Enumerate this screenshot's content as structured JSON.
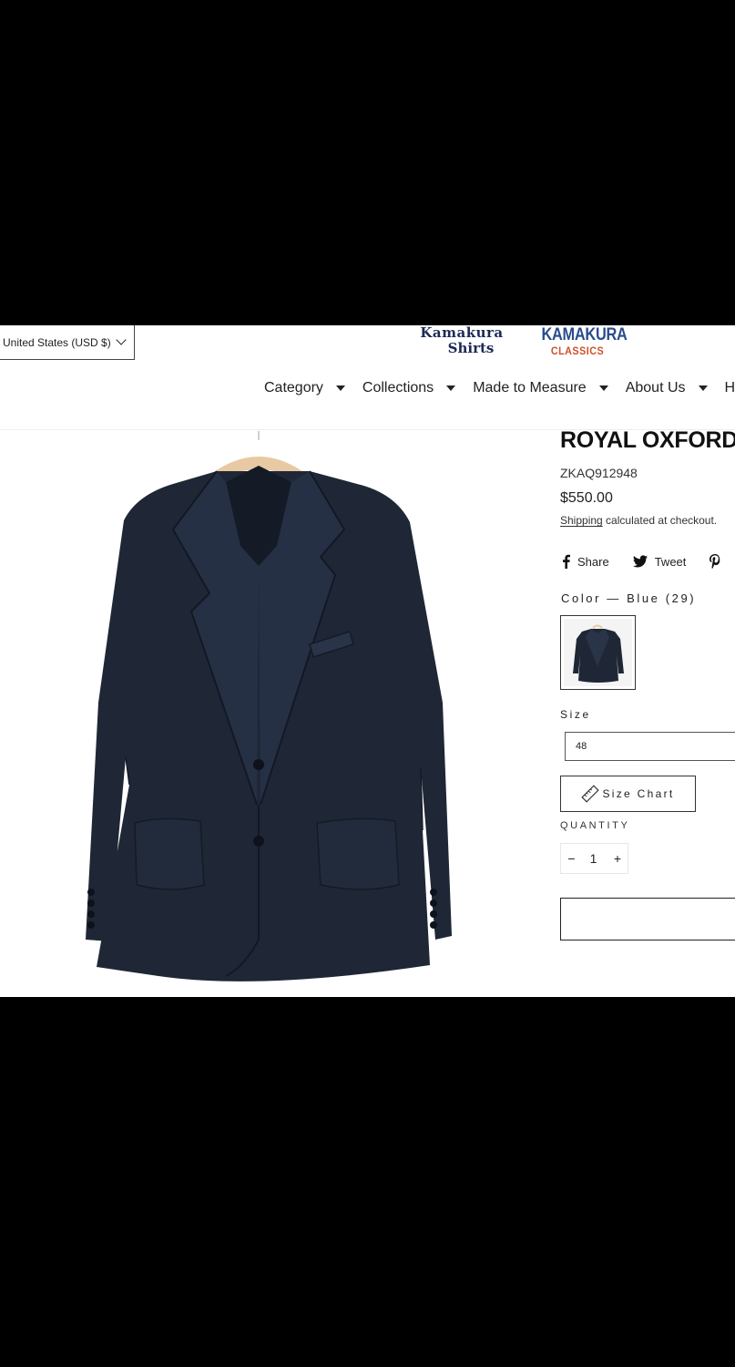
{
  "currency": {
    "label": "United States (USD $)"
  },
  "brand": {
    "shirts_logo": [
      "Kamakura",
      "Shirts"
    ],
    "classics_logo": [
      "KAMAKURA",
      "CLASSICS"
    ]
  },
  "nav": [
    {
      "label": "Category"
    },
    {
      "label": "Collections"
    },
    {
      "label": "Made to Measure"
    },
    {
      "label": "About Us"
    },
    {
      "label": "Help"
    }
  ],
  "product": {
    "title": "ROYAL OXFORD",
    "sku": "ZKAQ912948",
    "price": "$550.00",
    "shipping_link": "Shipping",
    "shipping_rest": " calculated at checkout.",
    "color_label": "Color — Blue (29)",
    "size_label": "Size",
    "size_value": "48",
    "size_chart_label": "Size Chart",
    "quantity_label": "QUANTITY",
    "quantity": "1",
    "qty_minus": "−",
    "qty_plus": "+"
  },
  "social": [
    {
      "label": "Share",
      "icon": "facebook-icon"
    },
    {
      "label": "Tweet",
      "icon": "twitter-icon"
    },
    {
      "label": "",
      "icon": "pinterest-icon"
    }
  ],
  "colors": {
    "jacket": "#1f2736",
    "hanger": "#e8c9a3",
    "logo_navy": "#1d2a55",
    "logo_blue": "#2a4c8c",
    "logo_orange": "#d0512b"
  }
}
